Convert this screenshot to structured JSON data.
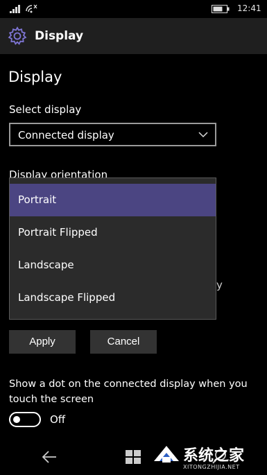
{
  "status_bar": {
    "time": "12:41",
    "icons": [
      "signal-icon",
      "wifi-icon",
      "battery-icon"
    ]
  },
  "header": {
    "icon": "gear-icon",
    "title": "Display"
  },
  "page": {
    "title": "Display",
    "select_display": {
      "label": "Select display",
      "value": "Connected display",
      "icon": "chevron-down-icon"
    },
    "orientation": {
      "label": "Display orientation",
      "options": [
        "Portrait",
        "Portrait Flipped",
        "Landscape",
        "Landscape Flipped"
      ],
      "selected": "Portrait"
    },
    "buttons": {
      "apply": "Apply",
      "cancel": "Cancel"
    },
    "dot_setting": {
      "label": "Show a dot on the connected display when you touch the screen",
      "toggle_state": "Off"
    }
  },
  "nav_bar": {
    "icons": [
      "back-icon",
      "windows-icon",
      "search-icon"
    ]
  },
  "watermark": {
    "name": "系统之家",
    "url": "XITONGZHIJIA.NET"
  },
  "colors": {
    "accent": "#4b4582",
    "header_bg": "#1f1f1f",
    "button_bg": "#333333",
    "dropdown_bg": "#2b2b2b"
  }
}
